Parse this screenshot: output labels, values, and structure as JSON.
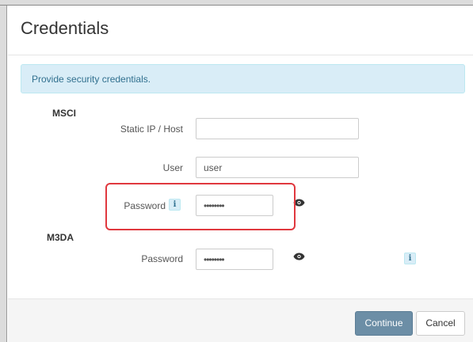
{
  "dialog": {
    "title": "Credentials",
    "alert": "Provide security credentials."
  },
  "msci": {
    "section_title": "MSCI",
    "host": {
      "label": "Static IP / Host",
      "value": ""
    },
    "user": {
      "label": "User",
      "value": "user"
    },
    "password": {
      "label": "Password",
      "value": "••••••••",
      "info_icon": "i"
    }
  },
  "m3da": {
    "section_title": "M3DA",
    "password": {
      "label": "Password",
      "value": "••••••••",
      "info_icon": "i"
    }
  },
  "footer": {
    "continue_label": "Continue",
    "cancel_label": "Cancel"
  },
  "colors": {
    "alert_bg": "#d9edf7",
    "alert_text": "#31708f",
    "highlight": "#e0383e",
    "primary_button": "#6c8ea6"
  }
}
